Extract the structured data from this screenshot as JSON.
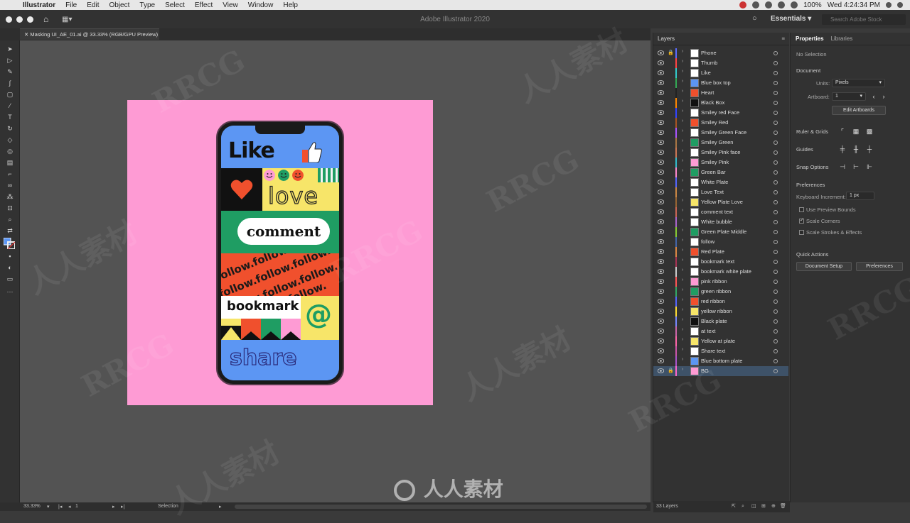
{
  "menubar": {
    "app": "Illustrator",
    "items": [
      "File",
      "Edit",
      "Object",
      "Type",
      "Select",
      "Effect",
      "View",
      "Window",
      "Help"
    ],
    "battery": "100%",
    "clock": "Wed 4:24:34 PM"
  },
  "appbar": {
    "title": "Adobe Illustrator 2020",
    "workspace": "Essentials",
    "search_placeholder": "Search Adobe Stock"
  },
  "document_tab": "Masking UI_AE_01.ai @ 33.33% (RGB/GPU Preview)",
  "artwork": {
    "like": "Like",
    "love": "love",
    "comment": "comment",
    "follow": "follow.",
    "bookmark": "bookmark",
    "at": "@",
    "share": "share"
  },
  "layers_panel": {
    "title": "Layers",
    "layers": [
      {
        "name": "Phone",
        "color": "#5b6cff",
        "thumb": "#ffffff",
        "locked": true
      },
      {
        "name": "Thumb",
        "color": "#ff4444",
        "thumb": "#ffffff",
        "locked": false
      },
      {
        "name": "Like",
        "color": "#33cccc",
        "thumb": "#ffffff",
        "locked": false
      },
      {
        "name": "Blue box top",
        "color": "#33aa55",
        "thumb": "#5c96f3",
        "locked": false
      },
      {
        "name": "Heart",
        "color": "#222222",
        "thumb": "#f0502d",
        "locked": false
      },
      {
        "name": "Black Box",
        "color": "#ff8800",
        "thumb": "#111111",
        "locked": false
      },
      {
        "name": "Smiley red Face",
        "color": "#3344ff",
        "thumb": "#ffffff",
        "locked": false
      },
      {
        "name": "Smiley Red",
        "color": "#aa5522",
        "thumb": "#f0502d",
        "locked": false
      },
      {
        "name": "Smiley Green Face",
        "color": "#aa55ff",
        "thumb": "#ffffff",
        "locked": false
      },
      {
        "name": "Smiley Green",
        "color": "#aa7744",
        "thumb": "#1f9d63",
        "locked": false
      },
      {
        "name": "Smiley Pink face",
        "color": "#cc7755",
        "thumb": "#ffffff",
        "locked": false
      },
      {
        "name": "Smiley Pink",
        "color": "#33bbcc",
        "thumb": "#fe9bd4",
        "locked": false
      },
      {
        "name": "Green Bar",
        "color": "#ff88cc",
        "thumb": "#1f9d63",
        "locked": false
      },
      {
        "name": "White Plate",
        "color": "#5566ff",
        "thumb": "#ffffff",
        "locked": false
      },
      {
        "name": "Love Text",
        "color": "#cc8844",
        "thumb": "#ffffff",
        "locked": false
      },
      {
        "name": "Yellow Plate Love",
        "color": "#996633",
        "thumb": "#f7e569",
        "locked": false
      },
      {
        "name": "comment text",
        "color": "#cc6655",
        "thumb": "#ffffff",
        "locked": false
      },
      {
        "name": "White bubble",
        "color": "#aa66cc",
        "thumb": "#ffffff",
        "locked": false
      },
      {
        "name": "Green Plate Middle",
        "color": "#88cc33",
        "thumb": "#1f9d63",
        "locked": false
      },
      {
        "name": "follow",
        "color": "#4466aa",
        "thumb": "#ffffff",
        "locked": false
      },
      {
        "name": "Red Plate",
        "color": "#dd8844",
        "thumb": "#f0502d",
        "locked": false
      },
      {
        "name": "bookmark text",
        "color": "#aa3355",
        "thumb": "#ffffff",
        "locked": false
      },
      {
        "name": "bookmark white plate",
        "color": "#cccccc",
        "thumb": "#ffffff",
        "locked": false
      },
      {
        "name": "pink ribbon",
        "color": "#ff5555",
        "thumb": "#fe9bd4",
        "locked": false
      },
      {
        "name": "green ribbon",
        "color": "#33aa66",
        "thumb": "#1f9d63",
        "locked": false
      },
      {
        "name": "red ribbon",
        "color": "#5566ff",
        "thumb": "#f0502d",
        "locked": false
      },
      {
        "name": "yellow ribbon",
        "color": "#ffdd33",
        "thumb": "#f7e569",
        "locked": false
      },
      {
        "name": "Black plate",
        "color": "#7788ff",
        "thumb": "#111111",
        "locked": false
      },
      {
        "name": "at text",
        "color": "#cc66aa",
        "thumb": "#ffffff",
        "locked": false
      },
      {
        "name": "Yellow at plate",
        "color": "#ff66aa",
        "thumb": "#f7e569",
        "locked": false
      },
      {
        "name": "Share text",
        "color": "#cc55aa",
        "thumb": "#ffffff",
        "locked": false
      },
      {
        "name": "Blue bottom plate",
        "color": "#aa55cc",
        "thumb": "#5c96f3",
        "locked": false
      },
      {
        "name": "BG",
        "color": "#ff66cc",
        "thumb": "#fe9bd4",
        "locked": true
      }
    ],
    "footer": "33 Layers"
  },
  "properties_panel": {
    "tabs": [
      "Properties",
      "Libraries"
    ],
    "selection": "No Selection",
    "document_label": "Document",
    "units_label": "Units:",
    "units_value": "Pixels",
    "artboard_label": "Artboard:",
    "artboard_value": "1",
    "edit_artboards": "Edit Artboards",
    "ruler_grids": "Ruler & Grids",
    "guides": "Guides",
    "snap_options": "Snap Options",
    "preferences_label": "Preferences",
    "keyboard_increment_label": "Keyboard Increment:",
    "keyboard_increment_value": "1 px",
    "use_preview_bounds": "Use Preview Bounds",
    "scale_corners": "Scale Corners",
    "scale_strokes": "Scale Strokes & Effects",
    "quick_actions": "Quick Actions",
    "document_setup": "Document Setup",
    "preferences_button": "Preferences"
  },
  "statusbar": {
    "zoom": "33.33%",
    "artboard": "1",
    "tool": "Selection"
  },
  "watermark": "RRCG",
  "watermark_cn": "人人素材"
}
